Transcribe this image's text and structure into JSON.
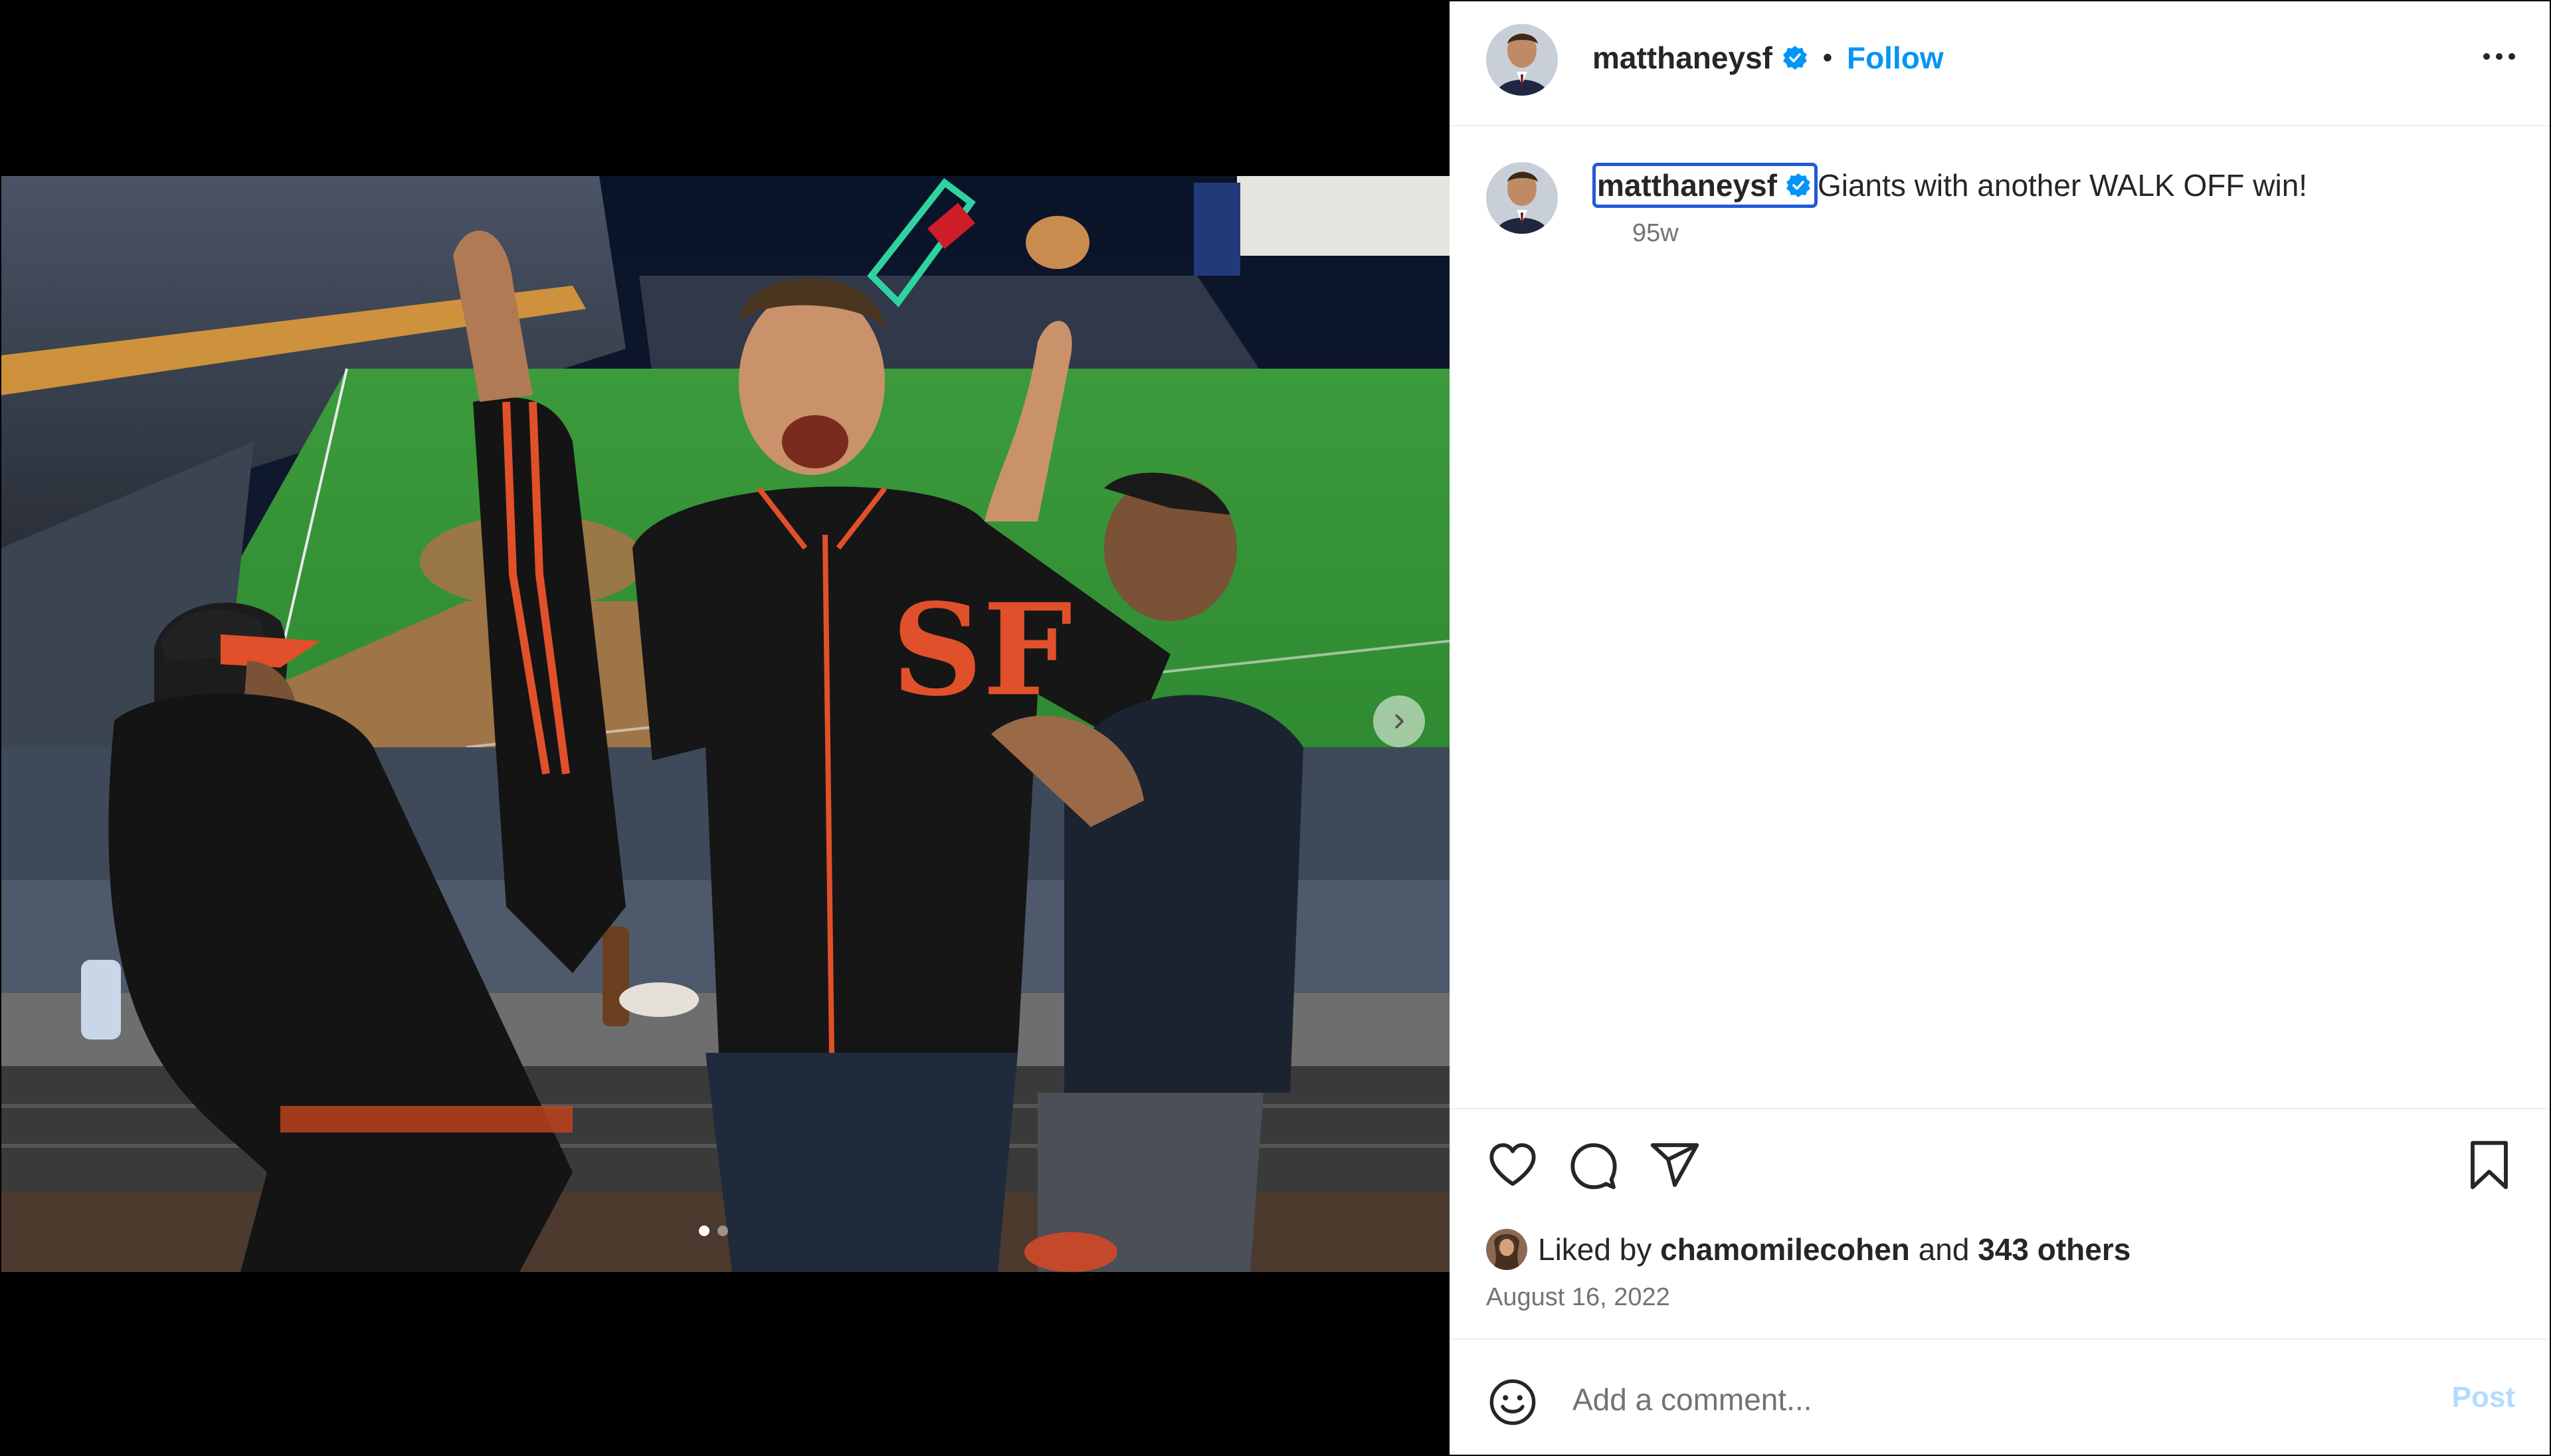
{
  "post": {
    "username": "matthaneysf",
    "follow_label": "Follow",
    "separator": "•",
    "caption_text": "Giants with another WALK OFF win!",
    "age": "95w",
    "liked_by_prefix": "Liked by",
    "liked_by_user": "chamomilecohen",
    "liked_by_and": "and",
    "liked_by_others": "343 others",
    "date": "August 16, 2022"
  },
  "comment": {
    "placeholder": "Add a comment...",
    "post_label": "Post"
  },
  "carousel": {
    "total_slides": 2,
    "active_slide": 1
  },
  "icons": {
    "verified": "verified-badge-icon",
    "more": "more-options-icon",
    "like": "heart-icon",
    "comment": "comment-bubble-icon",
    "share": "send-paper-plane-icon",
    "save": "bookmark-icon",
    "emoji": "emoji-smile-icon",
    "next": "chevron-right-icon"
  },
  "colors": {
    "follow": "#0095f6",
    "post_disabled": "#b3dbff",
    "verified": "#0095f6",
    "focus_outline": "#1f5bd8",
    "secondary_text": "#737373"
  }
}
